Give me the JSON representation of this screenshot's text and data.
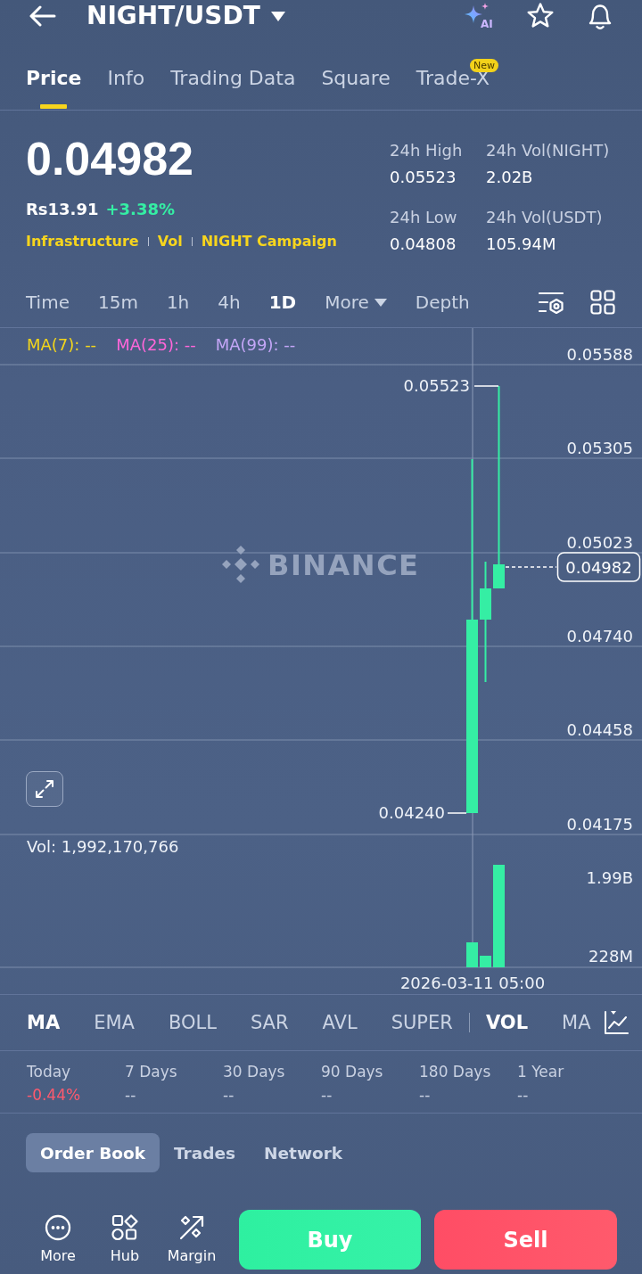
{
  "header": {
    "title": "NIGHT/USDT",
    "ai_label": "AI"
  },
  "tabs": [
    {
      "label": "Price",
      "selected": true
    },
    {
      "label": "Info",
      "selected": false
    },
    {
      "label": "Trading Data",
      "selected": false
    },
    {
      "label": "Square",
      "selected": false
    },
    {
      "label": "Trade-X",
      "selected": false,
      "badge": "New"
    }
  ],
  "ticker": {
    "price": "0.04982",
    "fiat": "Rs13.91",
    "change": "+3.38%",
    "negative": false,
    "tags": [
      "Infrastructure",
      "Vol",
      "NIGHT Campaign"
    ],
    "stats": [
      {
        "label": "24h High",
        "value": "0.05523"
      },
      {
        "label": "24h Vol(NIGHT)",
        "value": "2.02B"
      },
      {
        "label": "24h Low",
        "value": "0.04808"
      },
      {
        "label": "24h Vol(USDT)",
        "value": "105.94M"
      }
    ]
  },
  "intervals": [
    {
      "label": "Time",
      "kind": "option",
      "selected": false
    },
    {
      "label": "15m",
      "kind": "option",
      "selected": false
    },
    {
      "label": "1h",
      "kind": "option",
      "selected": false
    },
    {
      "label": "4h",
      "kind": "option",
      "selected": false
    },
    {
      "label": "1D",
      "kind": "option",
      "selected": true
    },
    {
      "label": "More",
      "kind": "dropdown",
      "selected": false
    },
    {
      "label": "Depth",
      "kind": "option",
      "selected": false
    }
  ],
  "chart": {
    "ma_legend": [
      {
        "label": "MA(7): --",
        "color": "#f2d51b"
      },
      {
        "label": "MA(25): --",
        "color": "#ff66d9"
      },
      {
        "label": "MA(99): --",
        "color": "#c4a6f7"
      }
    ],
    "watermark": "BINANCE",
    "price_axis": [
      "0.05588",
      "0.05305",
      "0.05023",
      "0.04740",
      "0.04458",
      "0.04175"
    ],
    "high_label": "0.05523",
    "low_label": "0.04240",
    "last_price": "0.04982",
    "volume_label": "Vol: 1,992,170,766",
    "volume_axis": [
      "1.99B",
      "228M"
    ],
    "time_label": "2026-03-11 05:00"
  },
  "indicators": {
    "main": [
      {
        "label": "MA",
        "selected": true
      },
      {
        "label": "EMA",
        "selected": false
      },
      {
        "label": "BOLL",
        "selected": false
      },
      {
        "label": "SAR",
        "selected": false
      },
      {
        "label": "AVL",
        "selected": false
      },
      {
        "label": "SUPER",
        "selected": false
      }
    ],
    "sub": [
      {
        "label": "VOL",
        "selected": true
      },
      {
        "label": "MA",
        "selected": false
      }
    ]
  },
  "performance": [
    {
      "label": "Today",
      "value": "-0.44%",
      "kind": "loss"
    },
    {
      "label": "7 Days",
      "value": "--",
      "kind": "blank"
    },
    {
      "label": "30 Days",
      "value": "--",
      "kind": "blank"
    },
    {
      "label": "90 Days",
      "value": "--",
      "kind": "blank"
    },
    {
      "label": "180 Days",
      "value": "--",
      "kind": "blank"
    },
    {
      "label": "1 Year",
      "value": "--",
      "kind": "blank"
    }
  ],
  "detail_tabs": [
    {
      "label": "Order Book",
      "selected": true
    },
    {
      "label": "Trades",
      "selected": false
    },
    {
      "label": "Network",
      "selected": false
    }
  ],
  "actions": [
    {
      "label": "More",
      "kind": "more"
    },
    {
      "label": "Hub",
      "kind": "hub"
    },
    {
      "label": "Margin",
      "kind": "margin"
    }
  ],
  "trade_buttons": [
    {
      "label": "Buy",
      "kind": "buy"
    },
    {
      "label": "Sell",
      "kind": "sell"
    }
  ]
}
